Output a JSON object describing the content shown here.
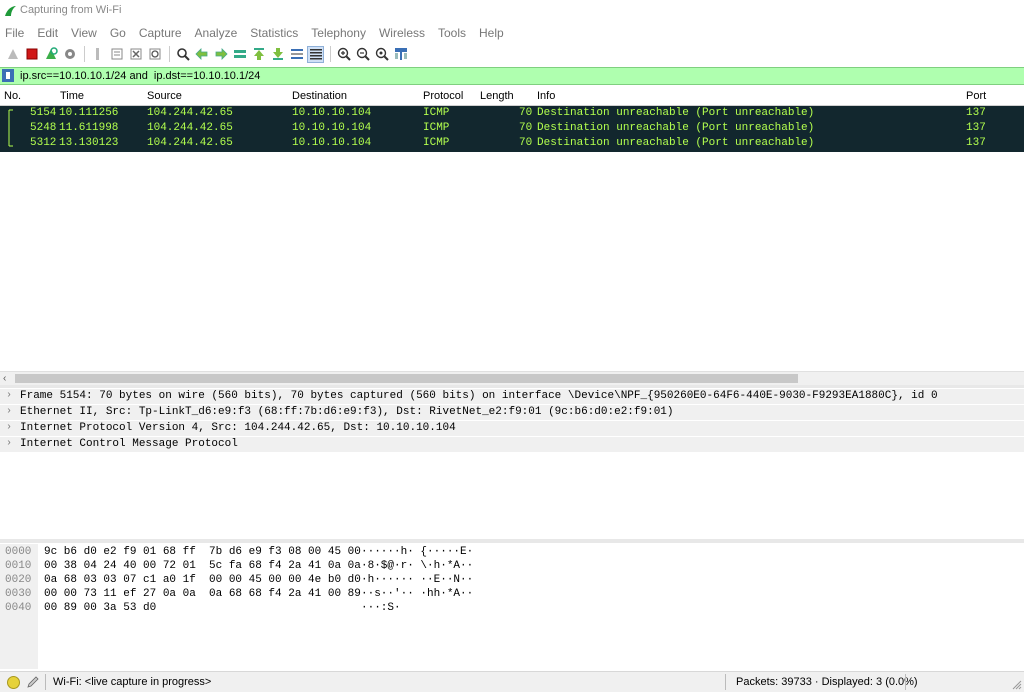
{
  "window": {
    "title": "Capturing from Wi-Fi"
  },
  "menu": [
    "File",
    "Edit",
    "View",
    "Go",
    "Capture",
    "Analyze",
    "Statistics",
    "Telephony",
    "Wireless",
    "Tools",
    "Help"
  ],
  "toolbar": {
    "icons": [
      "start-capture-icon",
      "stop-capture-icon",
      "restart-capture-icon",
      "capture-options-icon",
      "open-file-icon",
      "save-file-icon",
      "close-file-icon",
      "reload-icon",
      "find-packet-icon",
      "go-back-icon",
      "go-forward-icon",
      "go-to-packet-icon",
      "go-first-icon",
      "go-last-icon",
      "autoscroll-icon",
      "colorize-icon",
      "zoom-in-icon",
      "zoom-out-icon",
      "zoom-normal-icon",
      "resize-columns-icon"
    ]
  },
  "filter": {
    "value": "ip.src==10.10.10.1/24 and  ip.dst==10.10.10.1/24"
  },
  "packet_list": {
    "columns": [
      "No.",
      "Time",
      "Source",
      "Destination",
      "Protocol",
      "Length",
      "Info",
      "Port"
    ],
    "rows": [
      {
        "no": "5154",
        "time": "10.111256",
        "source": "104.244.42.65",
        "destination": "10.10.10.104",
        "protocol": "ICMP",
        "length": "70",
        "info": "Destination unreachable (Port unreachable)",
        "port": "137"
      },
      {
        "no": "5248",
        "time": "11.611998",
        "source": "104.244.42.65",
        "destination": "10.10.10.104",
        "protocol": "ICMP",
        "length": "70",
        "info": "Destination unreachable (Port unreachable)",
        "port": "137"
      },
      {
        "no": "5312",
        "time": "13.130123",
        "source": "104.244.42.65",
        "destination": "10.10.10.104",
        "protocol": "ICMP",
        "length": "70",
        "info": "Destination unreachable (Port unreachable)",
        "port": "137"
      }
    ],
    "row_bg": "#12272e",
    "row_fg": "#b3ff4e"
  },
  "details": [
    "Frame 5154: 70 bytes on wire (560 bits), 70 bytes captured (560 bits) on interface \\Device\\NPF_{950260E0-64F6-440E-9030-F9293EA1880C}, id 0",
    "Ethernet II, Src: Tp-LinkT_d6:e9:f3 (68:ff:7b:d6:e9:f3), Dst: RivetNet_e2:f9:01 (9c:b6:d0:e2:f9:01)",
    "Internet Protocol Version 4, Src: 104.244.42.65, Dst: 10.10.10.104",
    "Internet Control Message Protocol"
  ],
  "bytes": [
    {
      "offset": "0000",
      "hex": "9c b6 d0 e2 f9 01 68 ff  7b d6 e9 f3 08 00 45 00",
      "ascii": "······h· {·····E·"
    },
    {
      "offset": "0010",
      "hex": "00 38 04 24 40 00 72 01  5c fa 68 f4 2a 41 0a 0a",
      "ascii": "·8·$@·r· \\·h·*A··"
    },
    {
      "offset": "0020",
      "hex": "0a 68 03 03 07 c1 a0 1f  00 00 45 00 00 4e b0 d0",
      "ascii": "·h······ ··E··N··"
    },
    {
      "offset": "0030",
      "hex": "00 00 73 11 ef 27 0a 0a  0a 68 68 f4 2a 41 00 89",
      "ascii": "··s··'·· ·hh·*A··"
    },
    {
      "offset": "0040",
      "hex": "00 89 00 3a 53 d0",
      "ascii": "···:S·"
    }
  ],
  "status": {
    "interface": "Wi-Fi: <live capture in progress>",
    "packets": "Packets: 39733 · Displayed: 3 (0.0%)"
  }
}
